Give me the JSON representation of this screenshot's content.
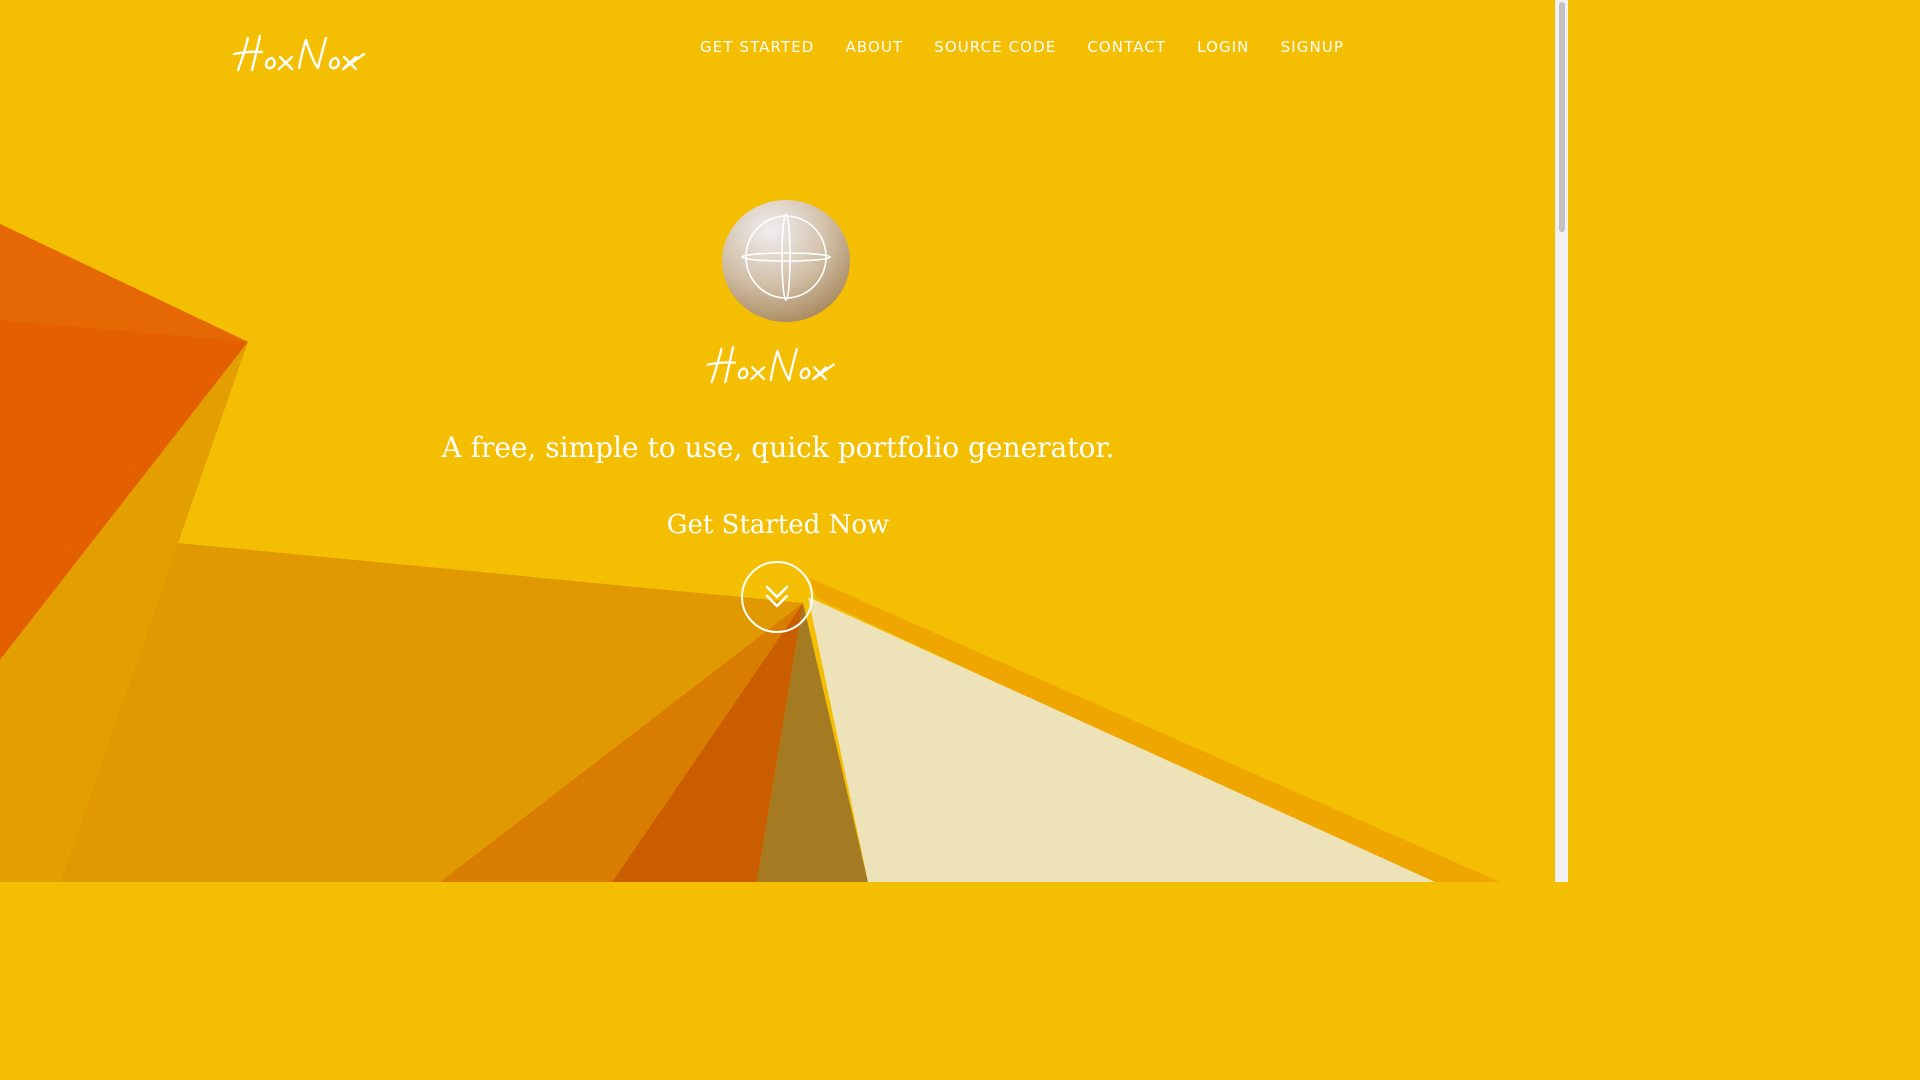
{
  "brand": {
    "name": "HoxNox"
  },
  "nav": {
    "items": [
      {
        "label": "GET STARTED"
      },
      {
        "label": "ABOUT"
      },
      {
        "label": "SOURCE CODE"
      },
      {
        "label": "CONTACT"
      },
      {
        "label": "LOGIN"
      },
      {
        "label": "SIGNUP"
      }
    ]
  },
  "hero": {
    "tagline": "A free, simple to use, quick portfolio generator.",
    "cta_label": "Get Started Now",
    "cta_icon": "double-chevron-down-icon",
    "badge_icon": "globe-icon"
  },
  "colors": {
    "background": "#F4BE02",
    "accent_orange": "#E35F00",
    "accent_amber": "#E09900",
    "accent_cream": "#EEE2B8",
    "accent_olive": "#A47A22",
    "text": "#FFFFFF"
  }
}
